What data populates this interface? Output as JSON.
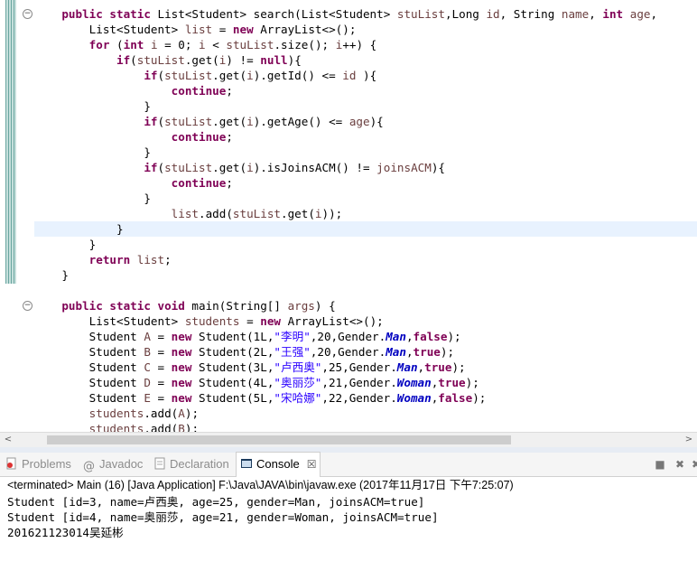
{
  "editor": {
    "lines": [
      {
        "hl": false,
        "segs": [
          [
            "    ",
            "p"
          ],
          [
            "public static ",
            "kw"
          ],
          [
            "List<Student> search(List<Student> ",
            "p"
          ],
          [
            "stuList",
            "var"
          ],
          [
            ",Long ",
            "p"
          ],
          [
            "id",
            "var"
          ],
          [
            ", String ",
            "p"
          ],
          [
            "name",
            "var"
          ],
          [
            ", ",
            "p"
          ],
          [
            "int ",
            "kw"
          ],
          [
            "age",
            "var"
          ],
          [
            ",",
            "p"
          ]
        ]
      },
      {
        "hl": false,
        "segs": [
          [
            "        List<Student> ",
            "p"
          ],
          [
            "list",
            "var"
          ],
          [
            " = ",
            "p"
          ],
          [
            "new ",
            "kw"
          ],
          [
            "ArrayList<>();",
            "p"
          ]
        ]
      },
      {
        "hl": false,
        "segs": [
          [
            "        ",
            "p"
          ],
          [
            "for ",
            "kw"
          ],
          [
            "(",
            "p"
          ],
          [
            "int ",
            "kw"
          ],
          [
            "i",
            "var"
          ],
          [
            " = 0; ",
            "p"
          ],
          [
            "i",
            "var"
          ],
          [
            " < ",
            "p"
          ],
          [
            "stuList",
            "var"
          ],
          [
            ".size(); ",
            "p"
          ],
          [
            "i",
            "var"
          ],
          [
            "++) {",
            "p"
          ]
        ]
      },
      {
        "hl": false,
        "segs": [
          [
            "            ",
            "p"
          ],
          [
            "if",
            "kw"
          ],
          [
            "(",
            "p"
          ],
          [
            "stuList",
            "var"
          ],
          [
            ".get(",
            "p"
          ],
          [
            "i",
            "var"
          ],
          [
            ") != ",
            "p"
          ],
          [
            "null",
            "kw"
          ],
          [
            "){",
            "p"
          ]
        ]
      },
      {
        "hl": false,
        "segs": [
          [
            "                ",
            "p"
          ],
          [
            "if",
            "kw"
          ],
          [
            "(",
            "p"
          ],
          [
            "stuList",
            "var"
          ],
          [
            ".get(",
            "p"
          ],
          [
            "i",
            "var"
          ],
          [
            ").getId() <= ",
            "p"
          ],
          [
            "id",
            "var"
          ],
          [
            " ){",
            "p"
          ]
        ]
      },
      {
        "hl": false,
        "segs": [
          [
            "                    ",
            "p"
          ],
          [
            "continue",
            "kw"
          ],
          [
            ";",
            "p"
          ]
        ]
      },
      {
        "hl": false,
        "segs": [
          [
            "                }",
            "p"
          ]
        ]
      },
      {
        "hl": false,
        "segs": [
          [
            "                ",
            "p"
          ],
          [
            "if",
            "kw"
          ],
          [
            "(",
            "p"
          ],
          [
            "stuList",
            "var"
          ],
          [
            ".get(",
            "p"
          ],
          [
            "i",
            "var"
          ],
          [
            ").getAge() <= ",
            "p"
          ],
          [
            "age",
            "var"
          ],
          [
            "){",
            "p"
          ]
        ]
      },
      {
        "hl": false,
        "segs": [
          [
            "                    ",
            "p"
          ],
          [
            "continue",
            "kw"
          ],
          [
            ";",
            "p"
          ]
        ]
      },
      {
        "hl": false,
        "segs": [
          [
            "                }",
            "p"
          ]
        ]
      },
      {
        "hl": false,
        "segs": [
          [
            "                ",
            "p"
          ],
          [
            "if",
            "kw"
          ],
          [
            "(",
            "p"
          ],
          [
            "stuList",
            "var"
          ],
          [
            ".get(",
            "p"
          ],
          [
            "i",
            "var"
          ],
          [
            ").isJoinsACM() != ",
            "p"
          ],
          [
            "joinsACM",
            "var"
          ],
          [
            "){",
            "p"
          ]
        ]
      },
      {
        "hl": false,
        "segs": [
          [
            "                    ",
            "p"
          ],
          [
            "continue",
            "kw"
          ],
          [
            ";",
            "p"
          ]
        ]
      },
      {
        "hl": false,
        "segs": [
          [
            "                }",
            "p"
          ]
        ]
      },
      {
        "hl": false,
        "segs": [
          [
            "                    ",
            "p"
          ],
          [
            "list",
            "var"
          ],
          [
            ".add(",
            "p"
          ],
          [
            "stuList",
            "var"
          ],
          [
            ".get(",
            "p"
          ],
          [
            "i",
            "var"
          ],
          [
            "));",
            "p"
          ]
        ]
      },
      {
        "hl": true,
        "segs": [
          [
            "            }",
            "p"
          ]
        ]
      },
      {
        "hl": false,
        "segs": [
          [
            "        }",
            "p"
          ]
        ]
      },
      {
        "hl": false,
        "segs": [
          [
            "        ",
            "p"
          ],
          [
            "return ",
            "kw"
          ],
          [
            "list",
            "var"
          ],
          [
            ";",
            "p"
          ]
        ]
      },
      {
        "hl": false,
        "segs": [
          [
            "    }",
            "p"
          ]
        ]
      },
      {
        "hl": false,
        "segs": [
          [
            "",
            "p"
          ]
        ]
      },
      {
        "hl": false,
        "segs": [
          [
            "    ",
            "p"
          ],
          [
            "public static void ",
            "kw"
          ],
          [
            "main(String[] ",
            "p"
          ],
          [
            "args",
            "var"
          ],
          [
            ") {",
            "p"
          ]
        ]
      },
      {
        "hl": false,
        "segs": [
          [
            "        List<Student> ",
            "p"
          ],
          [
            "students",
            "var"
          ],
          [
            " = ",
            "p"
          ],
          [
            "new ",
            "kw"
          ],
          [
            "ArrayList<>();",
            "p"
          ]
        ]
      },
      {
        "hl": false,
        "segs": [
          [
            "        Student ",
            "p"
          ],
          [
            "A",
            "var"
          ],
          [
            " = ",
            "p"
          ],
          [
            "new ",
            "kw"
          ],
          [
            "Student(1L,",
            "p"
          ],
          [
            "\"李明\"",
            "str"
          ],
          [
            ",20,Gender.",
            "p"
          ],
          [
            "Man",
            "fld"
          ],
          [
            ",",
            "p"
          ],
          [
            "false",
            "kw"
          ],
          [
            ");",
            "p"
          ]
        ]
      },
      {
        "hl": false,
        "segs": [
          [
            "        Student ",
            "p"
          ],
          [
            "B",
            "var"
          ],
          [
            " = ",
            "p"
          ],
          [
            "new ",
            "kw"
          ],
          [
            "Student(2L,",
            "p"
          ],
          [
            "\"王强\"",
            "str"
          ],
          [
            ",20,Gender.",
            "p"
          ],
          [
            "Man",
            "fld"
          ],
          [
            ",",
            "p"
          ],
          [
            "true",
            "kw"
          ],
          [
            ");",
            "p"
          ]
        ]
      },
      {
        "hl": false,
        "segs": [
          [
            "        Student ",
            "p"
          ],
          [
            "C",
            "var"
          ],
          [
            " = ",
            "p"
          ],
          [
            "new ",
            "kw"
          ],
          [
            "Student(3L,",
            "p"
          ],
          [
            "\"卢西奥\"",
            "str"
          ],
          [
            ",25,Gender.",
            "p"
          ],
          [
            "Man",
            "fld"
          ],
          [
            ",",
            "p"
          ],
          [
            "true",
            "kw"
          ],
          [
            ");",
            "p"
          ]
        ]
      },
      {
        "hl": false,
        "segs": [
          [
            "        Student ",
            "p"
          ],
          [
            "D",
            "var"
          ],
          [
            " = ",
            "p"
          ],
          [
            "new ",
            "kw"
          ],
          [
            "Student(4L,",
            "p"
          ],
          [
            "\"奥丽莎\"",
            "str"
          ],
          [
            ",21,Gender.",
            "p"
          ],
          [
            "Woman",
            "fld"
          ],
          [
            ",",
            "p"
          ],
          [
            "true",
            "kw"
          ],
          [
            ");",
            "p"
          ]
        ]
      },
      {
        "hl": false,
        "segs": [
          [
            "        Student ",
            "p"
          ],
          [
            "E",
            "var"
          ],
          [
            " = ",
            "p"
          ],
          [
            "new ",
            "kw"
          ],
          [
            "Student(5L,",
            "p"
          ],
          [
            "\"宋哈娜\"",
            "str"
          ],
          [
            ",22,Gender.",
            "p"
          ],
          [
            "Woman",
            "fld"
          ],
          [
            ",",
            "p"
          ],
          [
            "false",
            "kw"
          ],
          [
            ");",
            "p"
          ]
        ]
      },
      {
        "hl": false,
        "segs": [
          [
            "        ",
            "p"
          ],
          [
            "students",
            "var"
          ],
          [
            ".add(",
            "p"
          ],
          [
            "A",
            "var"
          ],
          [
            ");",
            "p"
          ]
        ]
      },
      {
        "hl": false,
        "segs": [
          [
            "        ",
            "p"
          ],
          [
            "students",
            "var"
          ],
          [
            ".add(",
            "p"
          ],
          [
            "B",
            "var"
          ],
          [
            ");",
            "p"
          ]
        ]
      }
    ],
    "fold_markers": [
      "−",
      "−"
    ]
  },
  "scrollbar": {
    "left_arrow": "<",
    "right_arrow": ">"
  },
  "tabs": {
    "problems": "Problems",
    "javadoc": "Javadoc",
    "declaration": "Declaration",
    "console": "Console",
    "close": "☒"
  },
  "console_status": "<terminated> Main (16) [Java Application] F:\\Java\\JAVA\\bin\\javaw.exe (2017年11月17日 下午7:25:07)",
  "console_output": [
    "Student [id=3, name=卢西奥, age=25, gender=Man, joinsACM=true]",
    "Student [id=4, name=奥丽莎, age=21, gender=Woman, joinsACM=true]",
    "201621123014吴延彬"
  ],
  "colors": {
    "keyword": "#7f0055",
    "variable": "#6a3e3e",
    "string": "#2a00ff",
    "field": "#0000c0",
    "highlight_line": "#e8f2fe"
  }
}
